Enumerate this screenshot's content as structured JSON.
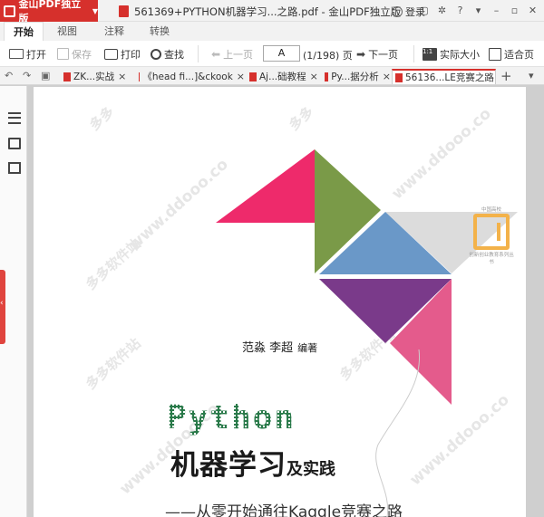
{
  "app": {
    "name": "金山PDF独立版",
    "window_title": "561369+PYTHON机器学习...之路.pdf - 金山PDF独立版",
    "login_label": "登录"
  },
  "ribbon_tabs": [
    "开始",
    "视图",
    "注释",
    "转换"
  ],
  "toolbar": {
    "open": "打开",
    "save": "保存",
    "print": "打印",
    "find": "查找",
    "prev": "上一页",
    "page_input": "A",
    "page_count": "(1/198) 页",
    "next": "下一页",
    "actual_size": "实际大小",
    "actual_size_icon": "1:1",
    "fit_page": "适合页"
  },
  "doc_tabs": [
    {
      "label": "ZK...实战"
    },
    {
      "label": "《head fi...]&ckook"
    },
    {
      "label": "Aj...础教程"
    },
    {
      "label": "Py...据分析"
    },
    {
      "label": "56136...LE竞赛之路"
    }
  ],
  "icons": {
    "close": "×",
    "add_tab": "+",
    "tab_menu": "▾",
    "undo": "↶",
    "redo": "↷"
  },
  "book": {
    "author_line": "范淼  李超",
    "author_suffix": "编著",
    "python_word": "Python",
    "title_main": "机器学习",
    "title_small": "及实践",
    "subtitle": "——从零开始通往Kaggle竞赛之路",
    "series_badge": "创新创业教育系列丛书",
    "series_badge_top": "中国高校"
  },
  "colors": {
    "accent": "#d6302c",
    "triangle_pink": "#ee2a6b",
    "triangle_olive": "#7a9a48",
    "triangle_blue": "#6a98c8",
    "triangle_grey": "#dcdcdc",
    "triangle_purple": "#7a3a8a",
    "triangle_rose": "#e45b8c",
    "badge": "#f3b24a"
  }
}
